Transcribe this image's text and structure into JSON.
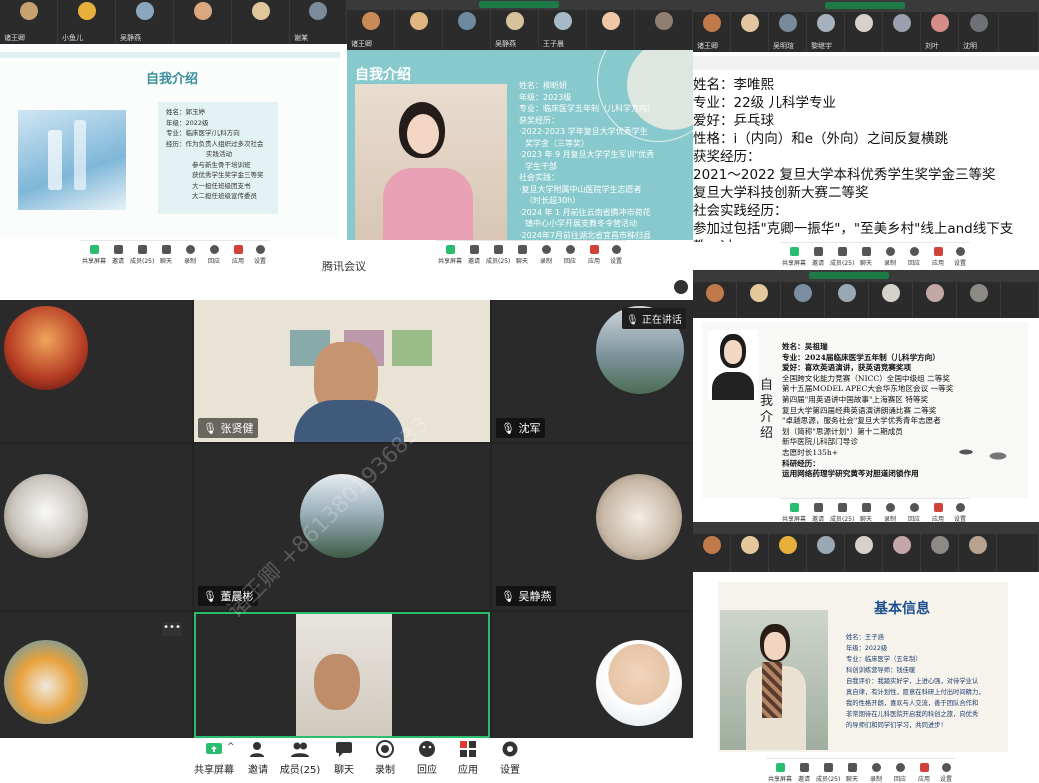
{
  "colors": {
    "teal": "#7ec5c9",
    "green": "#2bbd6e",
    "dark": "#2a2a2a",
    "paper": "#f6f3ec"
  },
  "toolbar_small": {
    "items": [
      "共享屏幕",
      "邀请",
      "成员(25)",
      "聊天",
      "录制",
      "回应",
      "应用",
      "设置"
    ]
  },
  "toolbar_small_b": {
    "items": [
      "共享屏幕",
      "邀请",
      "成员(25)",
      "聊天",
      "录制",
      "回应",
      "应用",
      "设置"
    ]
  },
  "toolbar_main": {
    "items": [
      "共享屏幕",
      "邀请",
      "成员(25)",
      "聊天",
      "录制",
      "回应",
      "应用",
      "设置"
    ],
    "icons": [
      "screen-share-icon",
      "invite-icon",
      "members-icon",
      "chat-icon",
      "record-icon",
      "reaction-icon",
      "apps-icon",
      "settings-icon"
    ]
  },
  "window_title": "腾讯会议",
  "strip1": {
    "names": [
      "诸王卿",
      "小鱼儿",
      "吴静燕",
      "",
      "",
      "谢某"
    ]
  },
  "strip2": {
    "names": [
      "诸王卿",
      "",
      "",
      "吴静燕",
      "王子晨",
      "",
      "",
      "",
      "",
      ""
    ]
  },
  "strip3": {
    "names": [
      "诸王卿",
      "吴明瑄",
      "黎继宇",
      "",
      "",
      "",
      "",
      "刘叶",
      "沈明"
    ]
  },
  "slide1": {
    "title": "自我介绍",
    "lines": [
      "姓名：郭玉婷",
      "年级：2022级",
      "专业：临床医学/儿科方向",
      "经历：作为负责人组织过多次社会",
      "实践活动",
      "参与新生骨干培训班",
      "获优秀学生奖学金三等奖",
      "大一担任班级团支书",
      "大二担任班级宣传委员"
    ]
  },
  "slide2": {
    "title": "自我介绍",
    "lines": [
      "姓名：柳昕妍",
      "年级：2023级",
      "专业：临床医学五年制（儿科学方向）",
      "获奖经历：",
      "·2022-2023 学年复旦大学优秀学生",
      "奖学金（三等奖）",
      "·2023 年 9 月复旦大学学生军训\"优秀",
      "学生干部",
      "社会实践：",
      "·复旦大学附属中山医院学生志愿者",
      "（时长超30h）",
      "·2024 年 1 月前往云南省腾冲市荷花",
      "镇中心小学开展支教冬令营活动",
      "·2024年7月前往湖北省宜昌市秭归县"
    ]
  },
  "slide3": {
    "lines": [
      "姓名：李唯熙",
      "专业：22级 儿科学专业",
      "爱好：乒乓球",
      "性格：i（内向）和e（外向）之间反复横跳",
      "获奖经历：",
      "2021～2022 复旦大学本科优秀学生奖学金三等奖",
      "复旦大学科技创新大赛二等奖",
      "社会实践经历：",
      "参加过包括\"克卿一振华\"，\"至美乡村\"线上and线下支教，过"
    ]
  },
  "slide4": {
    "side_title": "自我介绍",
    "lines": [
      "姓名：吴祖瑞",
      "专业：2024届临床医学五年制（儿科学方向）",
      "爱好：喜欢英语演讲，获英语竞赛奖项",
      "全国跨文化能力竞赛（NICC）全国中级组 二等奖",
      "第十五届MODEL APEC大会华东地区会议 一等奖",
      "第四届\"用英语讲中国故事\"上海赛区 特等奖",
      "复旦大学第四届经典英语演讲朗诵比赛 二等奖",
      "\"卓越思源，服务社会\"复旦大学优秀青年志愿者",
      "划（简称\"思源计划\"）第十二期成员",
      "新华医院儿科部门导诊",
      "志愿时长135h+",
      "科研经历：",
      "运用网络药理学研究黄芩对胆道闭锁作用"
    ]
  },
  "slide5": {
    "title": "基本信息",
    "lines": [
      "姓名：王子涵",
      "年级：2022级",
      "专业：临床医学（五年制）",
      "科创训练营导师：钱佳暖",
      "自我评价：我踏实好学，上进心强，对待学业认",
      "真自律，有计划性，愿意在科研上付出时间精力，",
      "我的性格开朗，喜欢与人交流，善于团队合作和",
      "非常期待在儿科医院开启我的科创之旅，向优秀",
      "的导师们和同学们学习，共同进步！"
    ]
  },
  "gallery": {
    "speaking_label": "正在讲话",
    "names": [
      "张贤健",
      "沈军",
      "董晨彬",
      "吴静燕"
    ]
  },
  "watermark": "诸王卿 +8613801936833"
}
